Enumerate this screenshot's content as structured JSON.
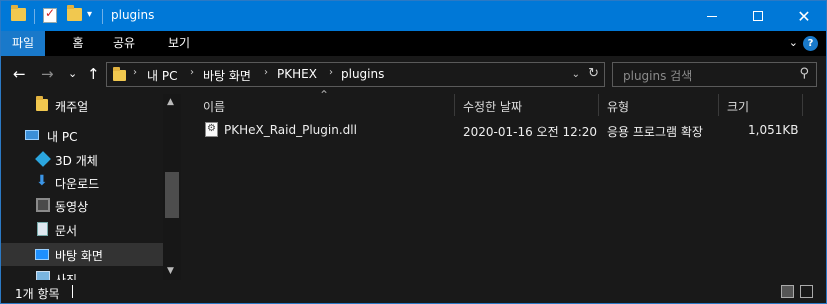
{
  "window": {
    "title": "plugins",
    "controls": {
      "minimize": "—",
      "maximize": "☐",
      "close": "✕"
    }
  },
  "ribbon": {
    "tabs": [
      "파일",
      "홈",
      "공유",
      "보기"
    ],
    "expand": "⌄",
    "help": "?"
  },
  "address": {
    "crumbs": [
      "내 PC",
      "바탕 화면",
      "PKHEX",
      "plugins"
    ],
    "search_placeholder": "plugins 검색"
  },
  "nav": {
    "back": "←",
    "forward": "→",
    "recent": "⌄",
    "up": "↑"
  },
  "navpane": {
    "items": [
      {
        "label": "캐주얼",
        "icon": "folder-icon"
      },
      {
        "label": "내 PC",
        "icon": "pc-icon"
      },
      {
        "label": "3D 개체",
        "icon": "3d-objects-icon"
      },
      {
        "label": "다운로드",
        "icon": "download-icon"
      },
      {
        "label": "동영상",
        "icon": "video-icon"
      },
      {
        "label": "문서",
        "icon": "document-icon"
      },
      {
        "label": "바탕 화면",
        "icon": "desktop-icon"
      },
      {
        "label": "사진",
        "icon": "pictures-icon"
      }
    ],
    "selected": "바탕 화면"
  },
  "filelist": {
    "columns": [
      "이름",
      "수정한 날짜",
      "유형",
      "크기"
    ],
    "rows": [
      {
        "name": "PKHeX_Raid_Plugin.dll",
        "modified": "2020-01-16 오전 12:20",
        "type": "응용 프로그램 확장",
        "size": "1,051KB",
        "icon": "dll-file-icon"
      }
    ]
  },
  "status": {
    "item_count": "1개 항목"
  },
  "colors": {
    "titlebar": "#0078d7",
    "file_tab": "#1979ca",
    "background": "#191919",
    "selection": "#333333"
  }
}
